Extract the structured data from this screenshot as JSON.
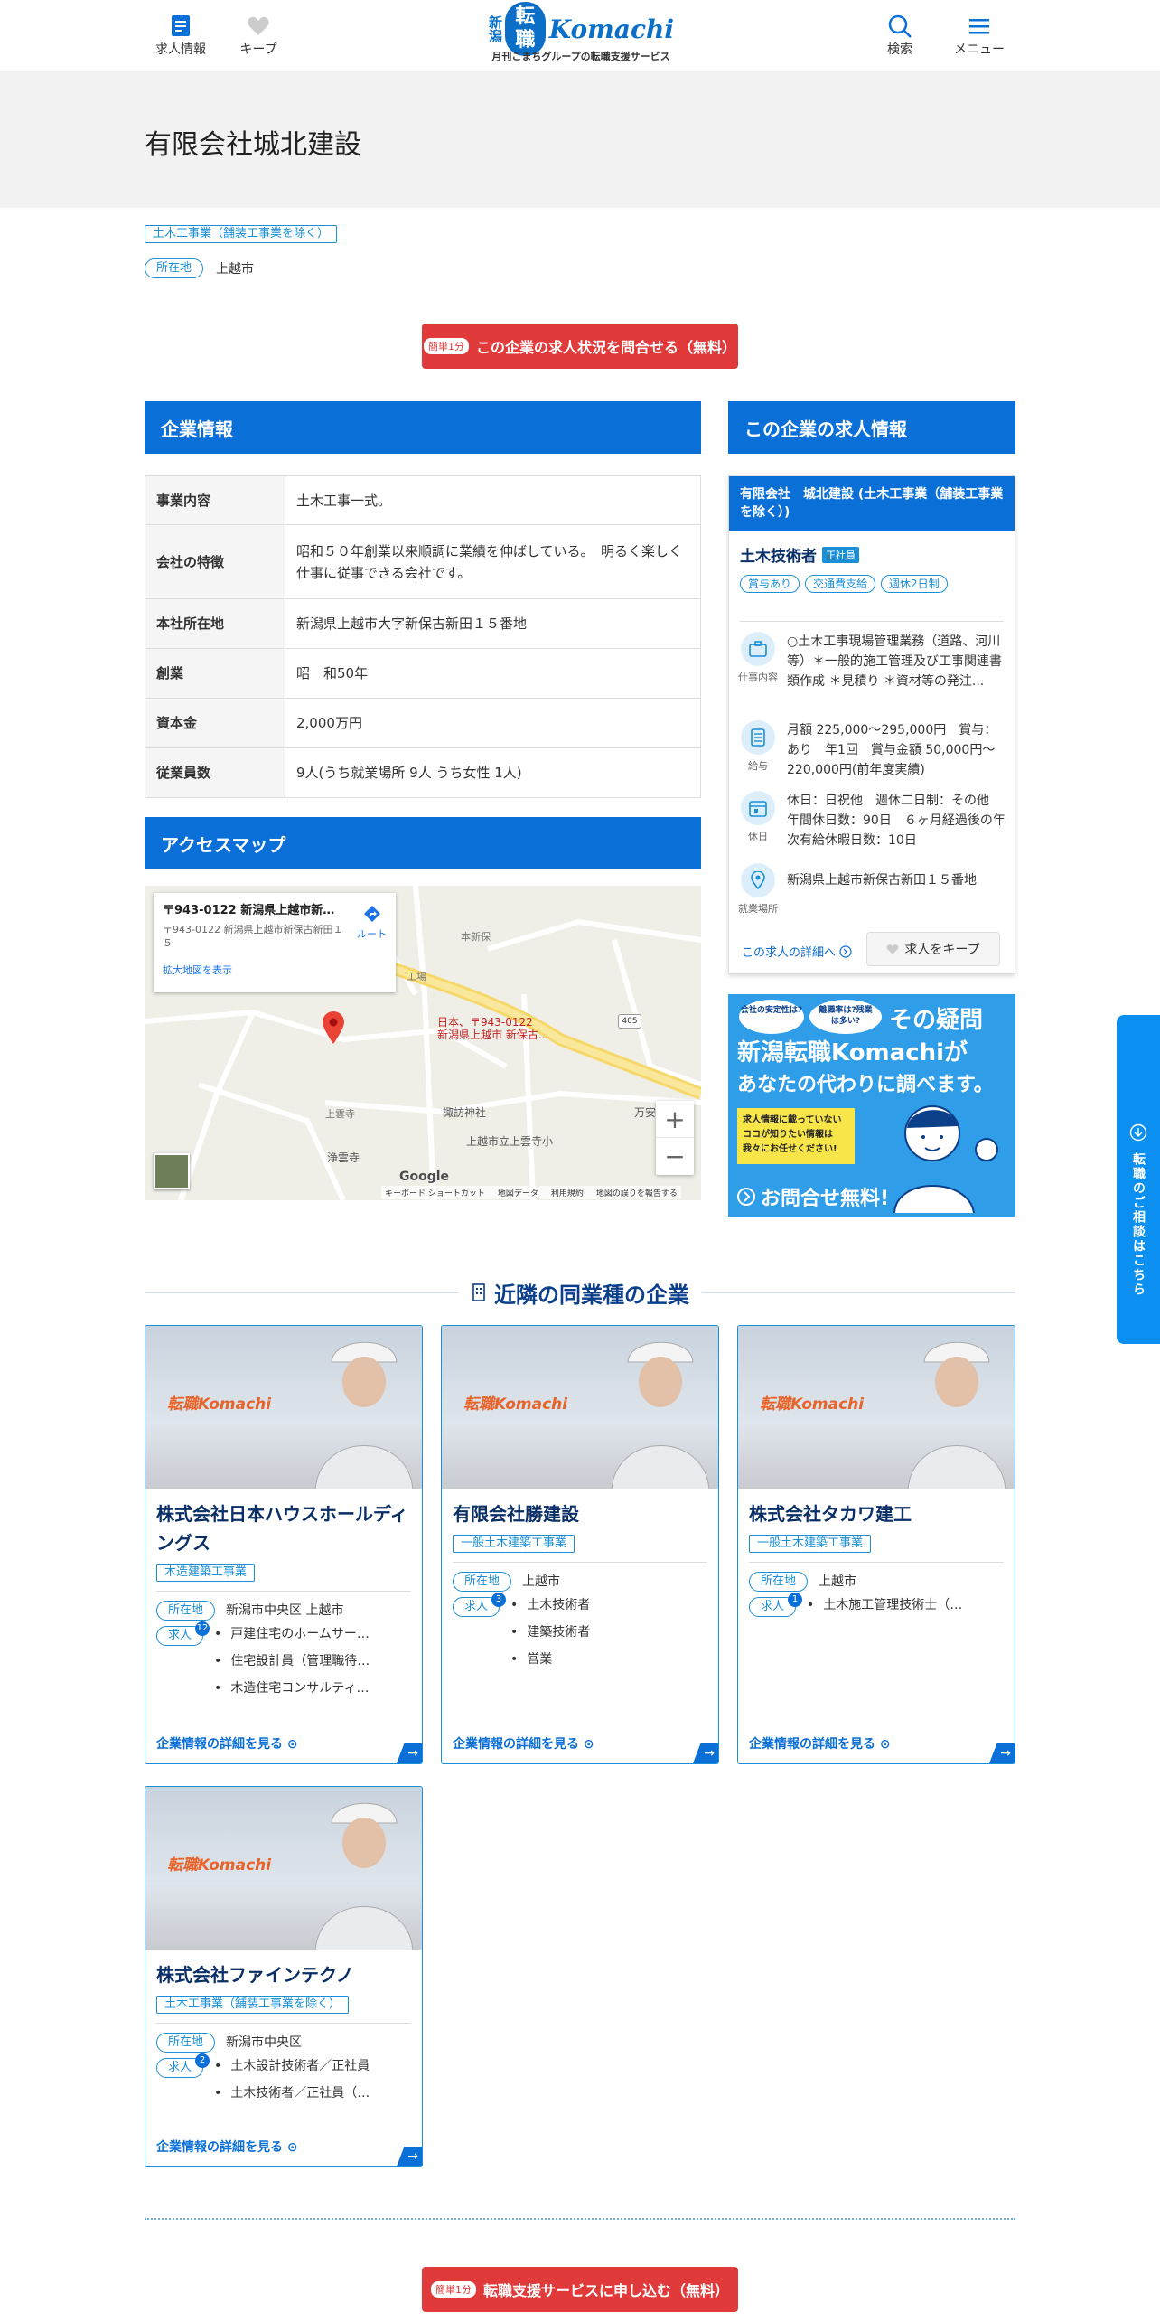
{
  "header": {
    "jobs_label": "求人情報",
    "keep_label": "キープ",
    "logo_nigata": "新潟",
    "logo_tenshoku": "転職",
    "logo_komachi": "Komachi",
    "logo_sub": "月刊こまちグループの転職支援サービス",
    "search_label": "検索",
    "menu_label": "メニュー"
  },
  "company": {
    "name": "有限会社城北建設",
    "industry_tag": "土木工事業（舗装工事業を除く）",
    "location_label": "所在地",
    "location": "上越市"
  },
  "inquiry_button": {
    "small": "簡単1分",
    "label": "この企業の求人状況を問合せる（無料）"
  },
  "company_info": {
    "heading": "企業情報",
    "rows": [
      {
        "label": "事業内容",
        "value": "土木工事一式。"
      },
      {
        "label": "会社の特徴",
        "value": "昭和５０年創業以来順調に業績を伸ばしている。　明るく楽しく仕事に従事できる会社です。"
      },
      {
        "label": "本社所在地",
        "value": "新潟県上越市大字新保古新田１５番地"
      },
      {
        "label": "創業",
        "value": "昭　和50年"
      },
      {
        "label": "資本金",
        "value": "2,000万円"
      },
      {
        "label": "従業員数",
        "value": "9人(うち就業場所 9人 うち女性 1人)"
      }
    ]
  },
  "access_map": {
    "heading": "アクセスマップ",
    "popup_title": "〒943-0122 新潟県上越市新保…",
    "popup_addr": "〒943-0122 新潟県上越市新保古新田１５",
    "popup_route": "ルート",
    "popup_link": "拡大地図を表示",
    "pin_label_1": "日本、〒943-0122",
    "pin_label_2": "新潟県上越市 新保古…",
    "place_honzaike": "本新保",
    "place_koujou": "工場",
    "place_joundera": "上雲寺",
    "place_suwa": "諏訪神社",
    "place_jounji": "浄雲寺",
    "place_school": "上越市立上雲寺小",
    "place_manan": "万安",
    "road_number": "405",
    "google": "Google",
    "footer_items": [
      "キーボード ショートカット",
      "地図データ",
      "利用規約",
      "地図の誤りを報告する"
    ],
    "zoom_in": "+",
    "zoom_out": "−"
  },
  "job_panel": {
    "heading": "この企業の求人情報",
    "card_header": "有限会社　城北建設 (土木工事業（舗装工事業を除く）)",
    "title": "土木技術者",
    "employment": "正社員",
    "tags": [
      "賞与あり",
      "交通費支給",
      "週休2日制"
    ],
    "rows": [
      {
        "icon_label": "仕事内容",
        "text": "○土木工事現場管理業務（道路、河川等）＊一般的施工管理及び工事関連書類作成 ＊見積り ＊資材等の発注..."
      },
      {
        "icon_label": "給与",
        "text": "月額 225,000～295,000円　賞与：あり　年1回　賞与金額 50,000円～220,000円(前年度実績)"
      },
      {
        "icon_label": "休日",
        "text": "休日：日祝他　週休二日制：その他　年間休日数：90日　６ヶ月経過後の年次有給休暇日数：10日"
      },
      {
        "icon_label": "就業場所",
        "text": "新潟県上越市新保古新田１５番地"
      }
    ],
    "detail_link": "この求人の詳細へ",
    "keep_button": "求人をキープ"
  },
  "banner": {
    "bubble1": "会社の安定性は?",
    "bubble2": "離職率は?残業は多い?",
    "headline1": "その疑問",
    "headline2": "新潟転職Komachiが",
    "headline3": "あなたの代わりに調べます。",
    "yellow1": "求人情報に載っていない",
    "yellow2": "ココが知りたい情報は",
    "yellow3": "我々にお任せください!",
    "cta": "お問合せ無料!"
  },
  "side_tab": {
    "label": "転職のご相談はこちら"
  },
  "nearby": {
    "heading": "近隣の同業種の企業",
    "location_label": "所在地",
    "jobs_label": "求人",
    "detail_link": "企業情報の詳細を見る",
    "photo_logo": "転職Komachi",
    "cards": [
      {
        "name": "株式会社日本ハウスホールディングス",
        "tag": "木造建築工事業",
        "location": "新潟市中央区 上越市",
        "count": "12",
        "jobs": [
          "戸建住宅のホームサー…",
          "住宅設計員（管理職待…",
          "木造住宅コンサルティ…"
        ]
      },
      {
        "name": "有限会社勝建設",
        "tag": "一般土木建築工事業",
        "location": "上越市",
        "count": "3",
        "jobs": [
          "土木技術者",
          "建築技術者",
          "営業"
        ]
      },
      {
        "name": "株式会社タカワ建工",
        "tag": "一般土木建築工事業",
        "location": "上越市",
        "count": "1",
        "jobs": [
          "土木施工管理技術士（…"
        ]
      },
      {
        "name": "株式会社ファインテクノ",
        "tag": "土木工事業（舗装工事業を除く）",
        "location": "新潟市中央区",
        "count": "2",
        "jobs": [
          "土木設計技術者／正社員",
          "土木技術者／正社員（…"
        ]
      }
    ]
  },
  "bottom_button": {
    "small": "簡単1分",
    "label": "転職支援サービスに申し込む（無料）"
  },
  "colors": {
    "accent": "#0b6fd8",
    "cta_red": "#e03a3a",
    "outline_blue": "#1a8fd6"
  },
  "icons": [
    "document-icon",
    "heart-icon",
    "search-icon",
    "menu-icon",
    "arrow-right-circle-icon",
    "briefcase-icon",
    "wallet-icon",
    "calendar-icon",
    "location-pin-icon",
    "building-icon",
    "download-circle-icon"
  ]
}
